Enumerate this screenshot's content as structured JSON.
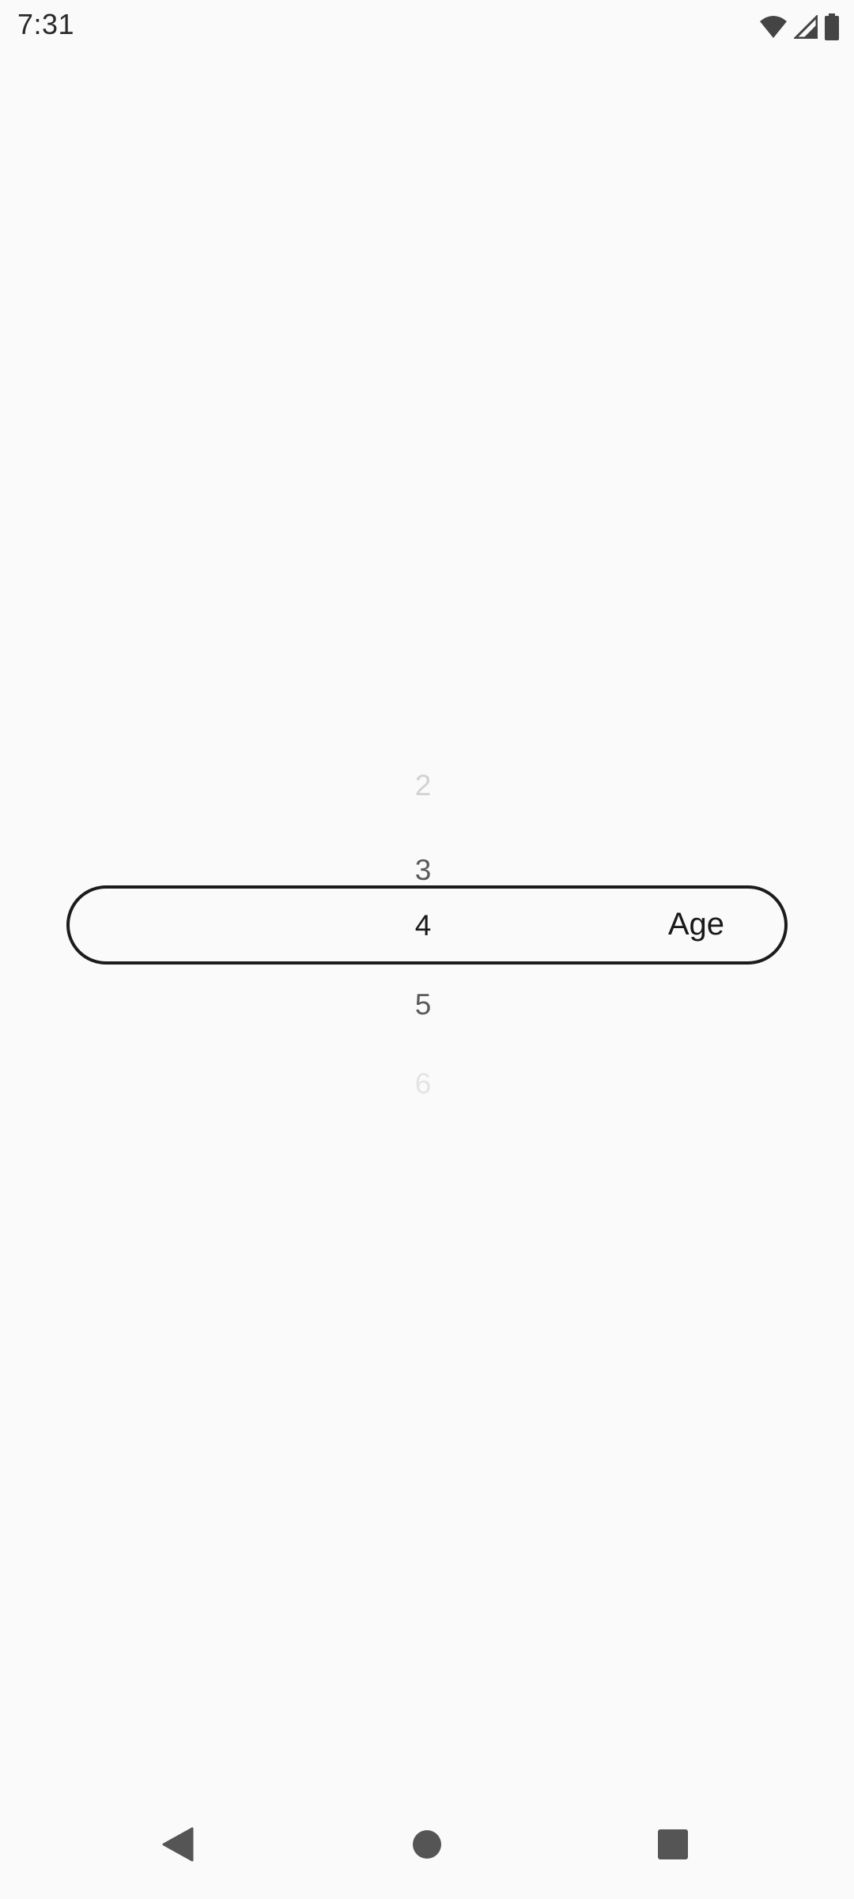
{
  "status_bar": {
    "time": "7:31",
    "icons": [
      "wifi-icon",
      "cellular-signal-icon",
      "battery-icon"
    ]
  },
  "picker": {
    "items": [
      {
        "value": "2",
        "state": "far"
      },
      {
        "value": "3",
        "state": "near"
      },
      {
        "value": "4",
        "state": "selected"
      },
      {
        "value": "5",
        "state": "near"
      },
      {
        "value": "6",
        "state": "farthest"
      }
    ],
    "selected_value": "4",
    "unit_label": "Age"
  },
  "nav_bar": {
    "buttons": [
      "back-icon",
      "home-icon",
      "recents-icon"
    ]
  },
  "colors": {
    "background": "#fafafa",
    "highlight_border": "#1c1c1e",
    "text_primary": "#1a1a1a"
  }
}
